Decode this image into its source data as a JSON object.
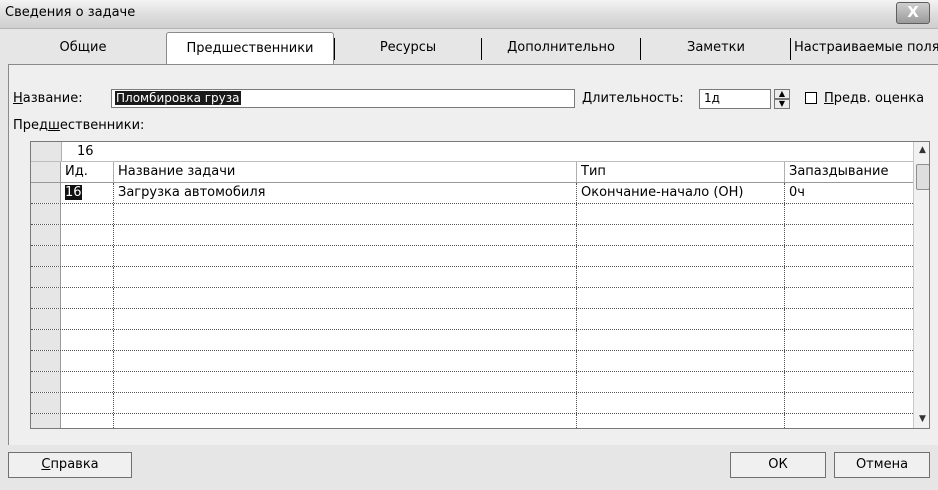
{
  "window": {
    "title": "Сведения о задаче",
    "close_glyph": "X"
  },
  "tabs": [
    {
      "label": "Общие"
    },
    {
      "label": "Предшественники",
      "active": true
    },
    {
      "label": "Ресурсы"
    },
    {
      "label": "Дополнительно"
    },
    {
      "label": "Заметки"
    },
    {
      "label": "Настраиваемые поля"
    }
  ],
  "form": {
    "name_label_u": "Н",
    "name_label_rest": "азвание:",
    "name_value": "Пломбировка груза",
    "duration_label_u": "Д",
    "duration_label_rest": "лительность:",
    "duration_value": "1д",
    "estimate_label_u": "П",
    "estimate_label_rest": "редв. оценка",
    "predecessors_label_a": "Пред",
    "predecessors_label_u": "ш",
    "predecessors_label_b": "ественники:"
  },
  "grid": {
    "entry_value": "16",
    "columns": [
      "Ид.",
      "Название задачи",
      "Тип",
      "Запаздывание"
    ],
    "rows": [
      {
        "id": "16",
        "name": "Загрузка автомобиля",
        "type": "Окончание-начало (ОН)",
        "lag": "0ч"
      }
    ],
    "empty_row_count": 11
  },
  "buttons": {
    "help_u": "С",
    "help_rest": "правка",
    "ok": "ОК",
    "cancel": "Отмена"
  },
  "icons": {
    "close": "close-icon",
    "spin_up": "triangle-up-icon",
    "spin_down": "triangle-down-icon",
    "scroll_up": "scroll-up-icon",
    "scroll_down": "scroll-down-icon"
  }
}
